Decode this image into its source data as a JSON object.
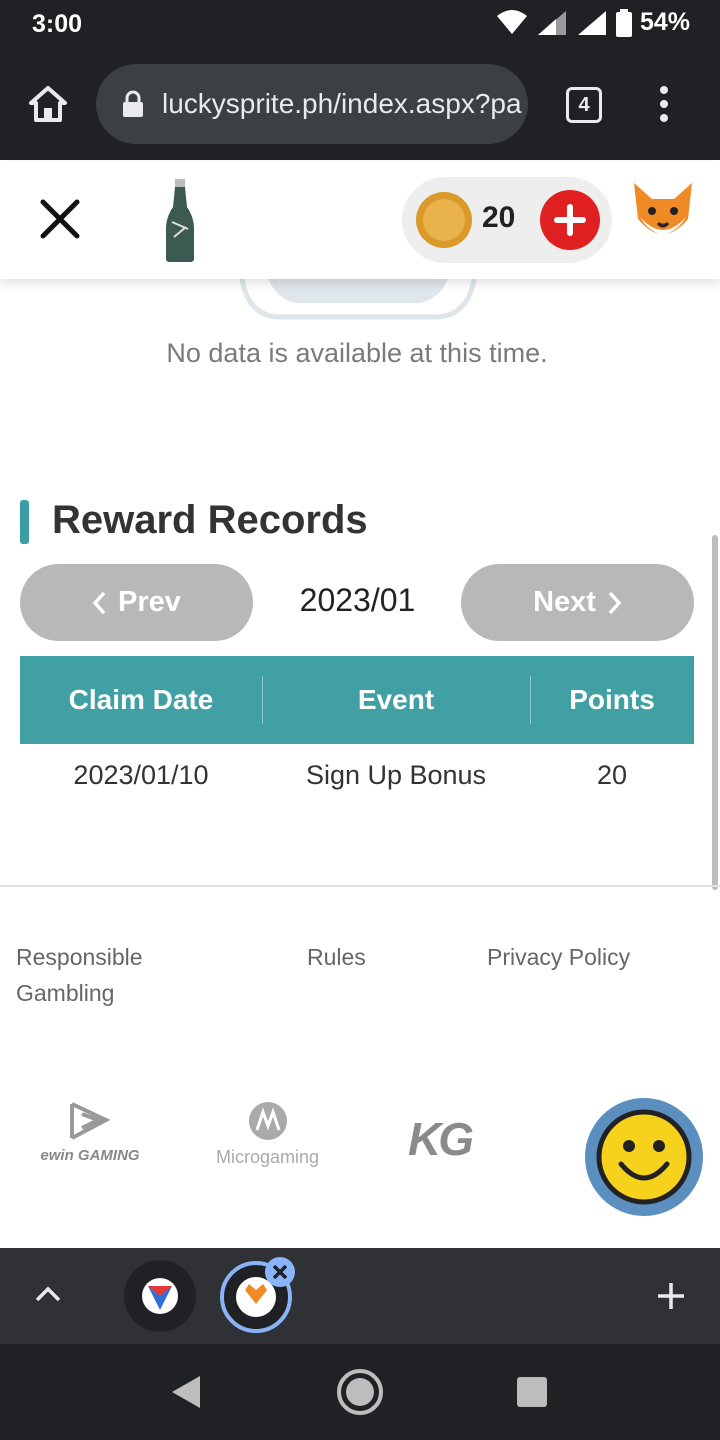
{
  "status_bar": {
    "time": "3:00",
    "battery": "54%"
  },
  "browser": {
    "url": "luckysprite.ph/index.aspx?pa",
    "tab_count": "4"
  },
  "header": {
    "coin_balance": "20"
  },
  "empty_state": {
    "message": "No data is available at this time."
  },
  "rewards": {
    "title": "Reward Records",
    "prev_label": "Prev",
    "next_label": "Next",
    "month": "2023/01",
    "columns": [
      "Claim Date",
      "Event",
      "Points"
    ],
    "rows": [
      {
        "date": "2023/01/10",
        "event": "Sign Up Bonus",
        "points": "20"
      }
    ]
  },
  "footer": {
    "links": [
      "Responsible Gambling",
      "Rules",
      "Privacy Policy"
    ],
    "partners": [
      "ewin GAMING",
      "Microgaming",
      "KG"
    ]
  },
  "colors": {
    "accent": "#40a0a3",
    "add_button": "#e02020",
    "nav_button": "#b8b8b8"
  }
}
